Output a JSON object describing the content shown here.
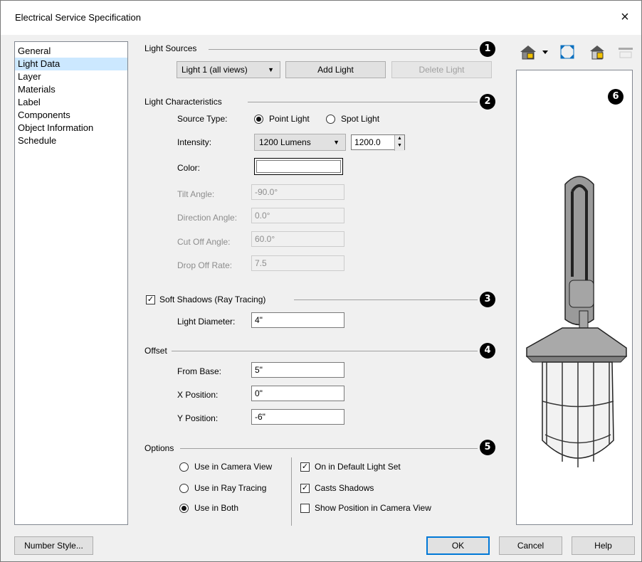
{
  "window": {
    "title": "Electrical Service Specification",
    "close_glyph": "×"
  },
  "sidebar": {
    "items": [
      {
        "label": "General"
      },
      {
        "label": "Light Data",
        "selected": true
      },
      {
        "label": "Layer"
      },
      {
        "label": "Materials"
      },
      {
        "label": "Label"
      },
      {
        "label": "Components"
      },
      {
        "label": "Object Information"
      },
      {
        "label": "Schedule"
      }
    ]
  },
  "light_sources": {
    "title": "Light Sources",
    "number": "1",
    "selected_light": "Light 1 (all views)",
    "add_label": "Add Light",
    "delete_label": "Delete Light"
  },
  "characteristics": {
    "title": "Light Characteristics",
    "number": "2",
    "source_type_label": "Source Type:",
    "point_light": "Point Light",
    "spot_light": "Spot Light",
    "source_type_selected": "Point Light",
    "intensity_label": "Intensity:",
    "intensity_preset": "1200 Lumens",
    "intensity_value": "1200.0",
    "color_label": "Color:",
    "color_value": "#ffffff",
    "tilt_label": "Tilt Angle:",
    "tilt_value": "-90.0°",
    "direction_label": "Direction Angle:",
    "direction_value": "0.0°",
    "cutoff_label": "Cut Off Angle:",
    "cutoff_value": "60.0°",
    "dropoff_label": "Drop Off Rate:",
    "dropoff_value": "7.5"
  },
  "soft_shadows": {
    "label": "Soft Shadows (Ray Tracing)",
    "checked": true,
    "number": "3",
    "diameter_label": "Light Diameter:",
    "diameter_value": "4\""
  },
  "offset": {
    "title": "Offset",
    "number": "4",
    "from_base_label": "From Base:",
    "from_base_value": "5\"",
    "x_label": "X Position:",
    "x_value": "0\"",
    "y_label": "Y Position:",
    "y_value": "-6\""
  },
  "options": {
    "title": "Options",
    "number": "5",
    "camera_view": "Use in Camera View",
    "ray_tracing": "Use in Ray Tracing",
    "both": "Use in Both",
    "use_selected": "Use in Both",
    "default_light_set": "On in Default Light Set",
    "default_light_set_checked": true,
    "casts_shadows": "Casts Shadows",
    "casts_shadows_checked": true,
    "show_position": "Show Position in Camera View",
    "show_position_checked": false
  },
  "preview": {
    "number": "6",
    "toolbar_icons": [
      "camera-view-dropdown-icon",
      "fill-window-icon",
      "render-view-icon",
      "toggle-view-icon"
    ]
  },
  "footer": {
    "number_style_label": "Number Style...",
    "ok_label": "OK",
    "cancel_label": "Cancel",
    "help_label": "Help"
  }
}
